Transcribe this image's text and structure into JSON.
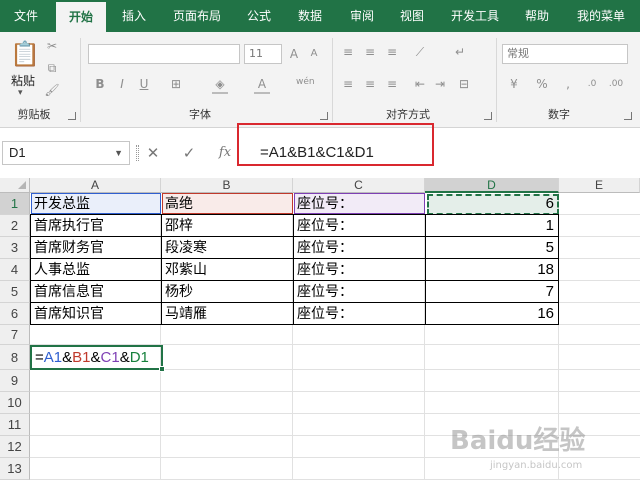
{
  "tabs": [
    "文件",
    "开始",
    "插入",
    "页面布局",
    "公式",
    "数据",
    "审阅",
    "视图",
    "开发工具",
    "帮助",
    "我的菜单"
  ],
  "active_tab": "开始",
  "ribbon": {
    "clipboard": {
      "paste_label": "粘贴",
      "group_label": "剪贴板"
    },
    "font": {
      "font_name": "",
      "font_size": "11",
      "group_label": "字体"
    },
    "alignment": {
      "group_label": "对齐方式"
    },
    "number": {
      "format": "常规",
      "group_label": "数字"
    }
  },
  "formula_bar": {
    "name_box": "D1",
    "cancel_icon": "✕",
    "enter_icon": "✓",
    "fx": "fx",
    "formula": "=A1&B1&C1&D1"
  },
  "columns": [
    "A",
    "B",
    "C",
    "D",
    "E"
  ],
  "rows": [
    "1",
    "2",
    "3",
    "4",
    "5",
    "6",
    "7",
    "8",
    "9",
    "10",
    "11",
    "12",
    "13"
  ],
  "table": [
    [
      "开发总监",
      "高绝",
      "座位号：",
      "6"
    ],
    [
      "首席执行官",
      "邵梓",
      "座位号：",
      "1"
    ],
    [
      "首席财务官",
      "段凌寒",
      "座位号：",
      "5"
    ],
    [
      "人事总监",
      "邓紫山",
      "座位号：",
      "18"
    ],
    [
      "首席信息官",
      "杨秒",
      "座位号：",
      "7"
    ],
    [
      "首席知识官",
      "马靖雁",
      "座位号：",
      "16"
    ]
  ],
  "a8_formula": {
    "eq": "=",
    "r1": "A1",
    "amp1": "&",
    "r2": "B1",
    "amp2": "&",
    "r3": "C1",
    "amp3": "&",
    "r4": "D1"
  },
  "colors": {
    "excel_green": "#217346",
    "ref_a": "#2f5fd0",
    "ref_b": "#c0392b",
    "ref_c": "#7e3fb4",
    "ref_d": "#16803c",
    "annotation_red": "#d9282f"
  },
  "watermark": {
    "brand": "Baidu经验",
    "url": "jingyan.baidu.com"
  }
}
